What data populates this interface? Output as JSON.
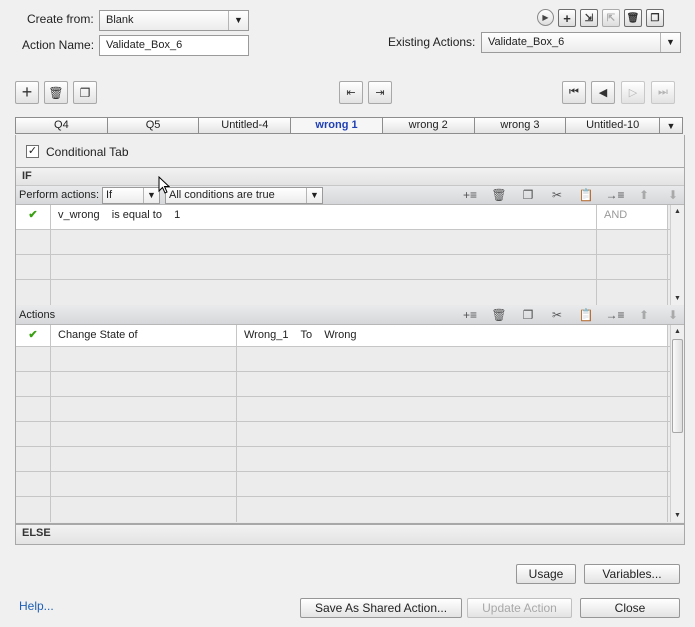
{
  "form": {
    "create_from_label": "Create from:",
    "create_from_value": "Blank",
    "action_name_label": "Action Name:",
    "action_name_value": "Validate_Box_6",
    "existing_actions_label": "Existing Actions:",
    "existing_actions_value": "Validate_Box_6"
  },
  "tabs": [
    {
      "label": "Q4"
    },
    {
      "label": "Q5"
    },
    {
      "label": "Untitled-4"
    },
    {
      "label": "wrong 1",
      "active": true
    },
    {
      "label": "wrong 2"
    },
    {
      "label": "wrong 3"
    },
    {
      "label": "Untitled-10"
    }
  ],
  "conditional_tab": {
    "label": "Conditional Tab",
    "checked": true
  },
  "if_section": {
    "header": "IF",
    "perform_actions_label": "Perform actions:",
    "perform_select": "If",
    "conditions_select": "All conditions are true",
    "rows": [
      {
        "check": "✔",
        "condition": "v_wrong    is equal to    1",
        "op": "AND"
      },
      {
        "check": "",
        "condition": "",
        "op": ""
      },
      {
        "check": "",
        "condition": "",
        "op": ""
      },
      {
        "check": "",
        "condition": "",
        "op": ""
      }
    ]
  },
  "actions_section": {
    "header": "Actions",
    "rows": [
      {
        "check": "✔",
        "action": "Change State of",
        "target": "Wrong_1    To    Wrong"
      },
      {
        "check": "",
        "action": "",
        "target": ""
      },
      {
        "check": "",
        "action": "",
        "target": ""
      },
      {
        "check": "",
        "action": "",
        "target": ""
      },
      {
        "check": "",
        "action": "",
        "target": ""
      },
      {
        "check": "",
        "action": "",
        "target": ""
      },
      {
        "check": "",
        "action": "",
        "target": ""
      },
      {
        "check": "",
        "action": "",
        "target": ""
      }
    ]
  },
  "else_section": {
    "header": "ELSE"
  },
  "buttons": {
    "usage": "Usage",
    "variables": "Variables...",
    "help": "Help...",
    "save_shared": "Save As Shared Action...",
    "update": "Update Action",
    "close": "Close"
  },
  "icons": {
    "dropdown_arrow": "▼",
    "scroll_up": "▲",
    "scroll_down": "▼"
  }
}
